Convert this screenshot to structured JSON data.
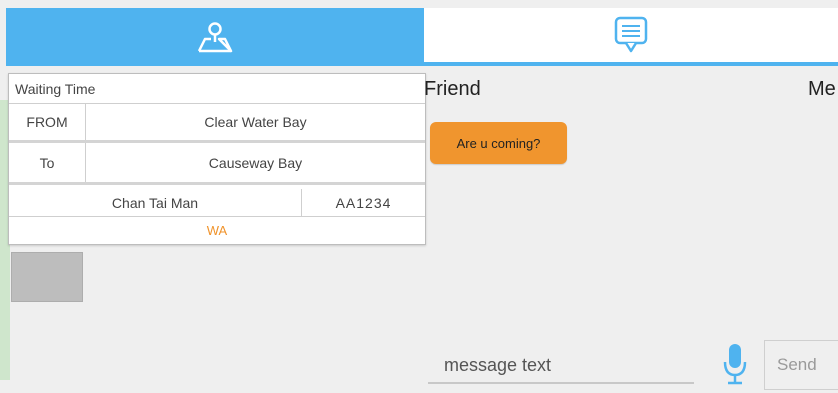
{
  "tabs": [
    {
      "name": "map",
      "icon": "map-pin-icon",
      "selected": true
    },
    {
      "name": "chat",
      "icon": "chat-bubble-icon",
      "selected": false
    }
  ],
  "info": {
    "title": "Waiting Time",
    "from_label": "FROM",
    "from_value": "Clear Water Bay",
    "to_label": "To",
    "to_value": "Causeway Bay",
    "driver_name": "Chan Tai Man",
    "plate": "AA1234",
    "status": "WA"
  },
  "chat": {
    "friend_label": "Friend",
    "me_label": "Me",
    "messages": [
      {
        "from": "friend",
        "text": "Are u coming?"
      }
    ],
    "input_placeholder": "message text",
    "send_label": "Send"
  },
  "colors": {
    "accent_blue": "#4fb3ef",
    "bubble_orange": "#f0952e",
    "status_orange": "#f0932b"
  }
}
